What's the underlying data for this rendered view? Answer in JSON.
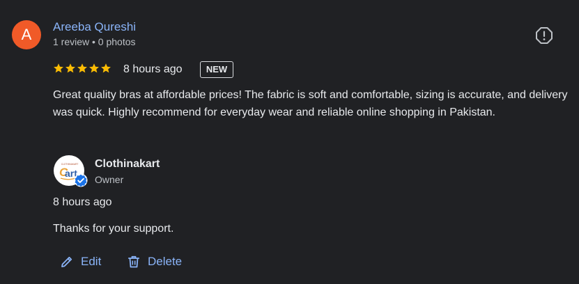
{
  "review": {
    "avatar_letter": "A",
    "reviewer_name": "Areeba Qureshi",
    "reviewer_meta": "1 review • 0 photos",
    "rating": 5,
    "time": "8 hours ago",
    "badge": "NEW",
    "text": "Great quality bras at affordable prices! The fabric is soft and comfortable, sizing is accurate, and delivery was quick. Highly recommend for everyday wear and reliable online shopping in Pakistan.",
    "report_icon": "report-icon"
  },
  "owner_reply": {
    "owner_name": "Clothinakart",
    "owner_role": "Owner",
    "time": "8 hours ago",
    "text": "Thanks for your support.",
    "logo_icon": "cart-logo",
    "verified_icon": "verified-check-icon"
  },
  "actions": {
    "edit_label": "Edit",
    "delete_label": "Delete",
    "edit_icon": "pencil-icon",
    "delete_icon": "trash-icon"
  },
  "colors": {
    "background": "#202124",
    "accent_link": "#8ab4f8",
    "avatar": "#f05a28",
    "star": "#fbbc04",
    "verified": "#1a73e8"
  }
}
